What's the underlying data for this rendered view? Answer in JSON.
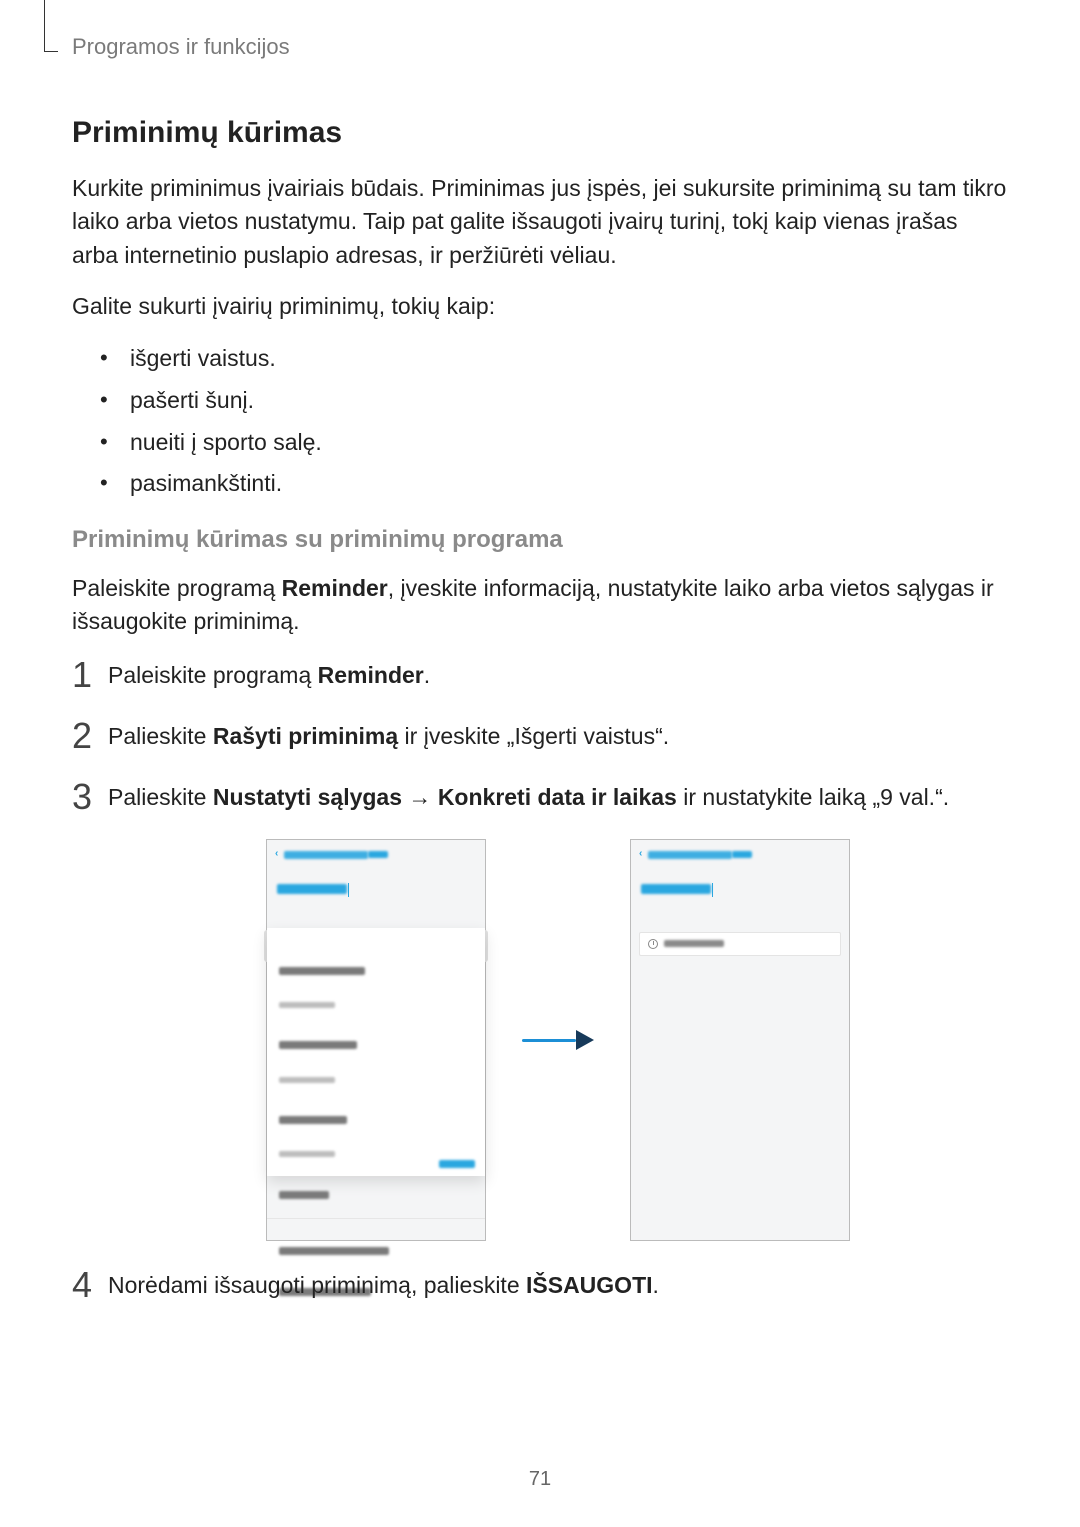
{
  "breadcrumb": "Programos ir funkcijos",
  "title": "Priminimų kūrimas",
  "intro": "Kurkite priminimus įvairiais būdais. Priminimas jus įspės, jei sukursite priminimą su tam tikro laiko arba vietos nustatymu. Taip pat galite išsaugoti įvairų turinį, tokį kaip vienas įrašas arba internetinio puslapio adresas, ir peržiūrėti vėliau.",
  "examples_lead": "Galite sukurti įvairių priminimų, tokių kaip:",
  "bullets": [
    "išgerti vaistus.",
    "pašerti šunį.",
    "nueiti į sporto salę.",
    "pasimankštinti."
  ],
  "subheading": "Priminimų kūrimas su priminimų programa",
  "sub_intro_pre": "Paleiskite programą ",
  "sub_intro_bold": "Reminder",
  "sub_intro_post": ", įveskite informaciją, nustatykite laiko arba vietos sąlygas ir išsaugokite priminimą.",
  "steps": {
    "s1_num": "1",
    "s1_pre": "Paleiskite programą ",
    "s1_bold": "Reminder",
    "s1_post": ".",
    "s2_num": "2",
    "s2_pre": "Palieskite ",
    "s2_bold": "Rašyti priminimą",
    "s2_post": " ir įveskite „Išgerti vaistus“.",
    "s3_num": "3",
    "s3_pre": "Palieskite ",
    "s3_bold1": "Nustatyti sąlygas",
    "s3_arrow": " → ",
    "s3_bold2": "Konkreti data ir laikas",
    "s3_post": " ir nustatykite laiką „9 val.“.",
    "s4_num": "4",
    "s4_pre": "Norėdami išsaugoti priminimą, palieskite ",
    "s4_bold": "IŠSAUGOTI",
    "s4_post": "."
  },
  "page_number": "71"
}
